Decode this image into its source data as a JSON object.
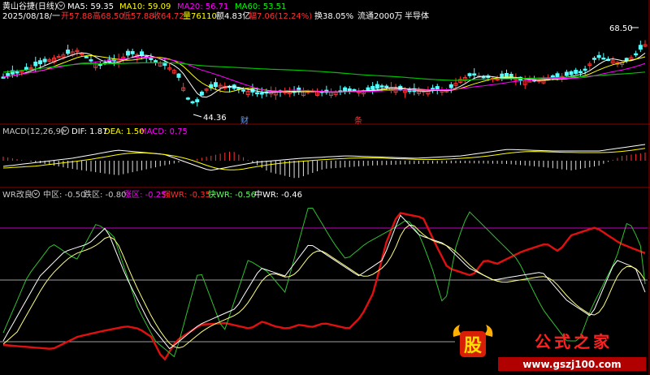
{
  "stock": {
    "name": "黄山谷捷(日线)",
    "ma_items": [
      {
        "label": "MA5: 59.35",
        "color": "#ffffff"
      },
      {
        "label": "MA10: 59.09",
        "color": "#ffff00"
      },
      {
        "label": "MA20: 56.71",
        "color": "#ff00ff"
      },
      {
        "label": "MA60: 53.51",
        "color": "#00ff00"
      }
    ],
    "quote": {
      "date": "2025/08/18/一",
      "open": "开57.88",
      "high": "高68.50",
      "low": "低57.88",
      "close": "收64.72",
      "volume": "量76110",
      "amount": "额4.83亿",
      "change": "幅7.06(12.24%)",
      "turnover": "换38.05%",
      "float": "流通2000万",
      "sector": "半导体"
    },
    "price_high_marker": "68.50",
    "price_low_marker": "44.36",
    "event_marks": [
      "财",
      "条"
    ]
  },
  "macd": {
    "title": "MACD(12,26,9)",
    "dif": "DIF: 1.87",
    "dea": "DEA: 1.50",
    "macd": "MACD: 0.75"
  },
  "wr": {
    "title": "WR改良",
    "items": [
      {
        "label": "中区: -0.50",
        "color": "#c8c8c8"
      },
      {
        "label": "跌区: -0.80",
        "color": "#c8c8c8"
      },
      {
        "label": "涨区: -0.25",
        "color": "#ff00ff"
      },
      {
        "label": "强WR: -0.35",
        "color": "#ff3030"
      },
      {
        "label": "快WR: -0.56",
        "color": "#60ff60"
      },
      {
        "label": "中WR: -0.46",
        "color": "#ffffff"
      }
    ]
  },
  "watermark": {
    "logo_char": "股",
    "title": "公式之家",
    "url": "www.gszj100.com"
  },
  "colors": {
    "bg": "#000000",
    "up": "#ff3232",
    "down": "#54ffff",
    "divider": "#8b0000",
    "ma5": "#ffffff",
    "ma10": "#ffff00",
    "ma20": "#ff00ff",
    "ma60": "#00c000"
  }
}
